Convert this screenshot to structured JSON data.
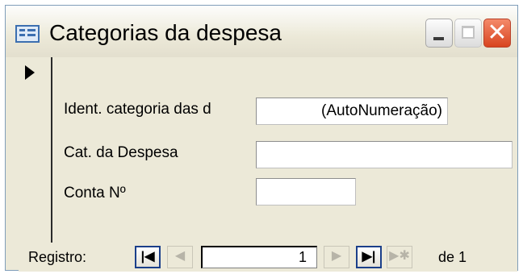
{
  "window": {
    "title": "Categorias da despesa",
    "icon": "form-icon",
    "buttons": {
      "minimize": "minimize",
      "maximize": "maximize",
      "close": "✕"
    }
  },
  "record_selector": {
    "current_marker": "record-arrow-icon"
  },
  "fields": [
    {
      "label": "Ident. categoria das d",
      "value": "(AutoNumeração)"
    },
    {
      "label": "Cat. da Despesa",
      "value": ""
    },
    {
      "label": "Conta Nº",
      "value": ""
    }
  ],
  "navigation": {
    "label": "Registro:",
    "first_glyph": "|◀",
    "prev_glyph": "◀",
    "current_record": "1",
    "next_glyph": "▶",
    "last_glyph": "▶|",
    "new_glyph": "▶✱",
    "of_label": "de 1"
  },
  "colors": {
    "window_bg": "#ece9d8",
    "close_button": "#d8441f",
    "active_border": "#1b3f8a"
  }
}
